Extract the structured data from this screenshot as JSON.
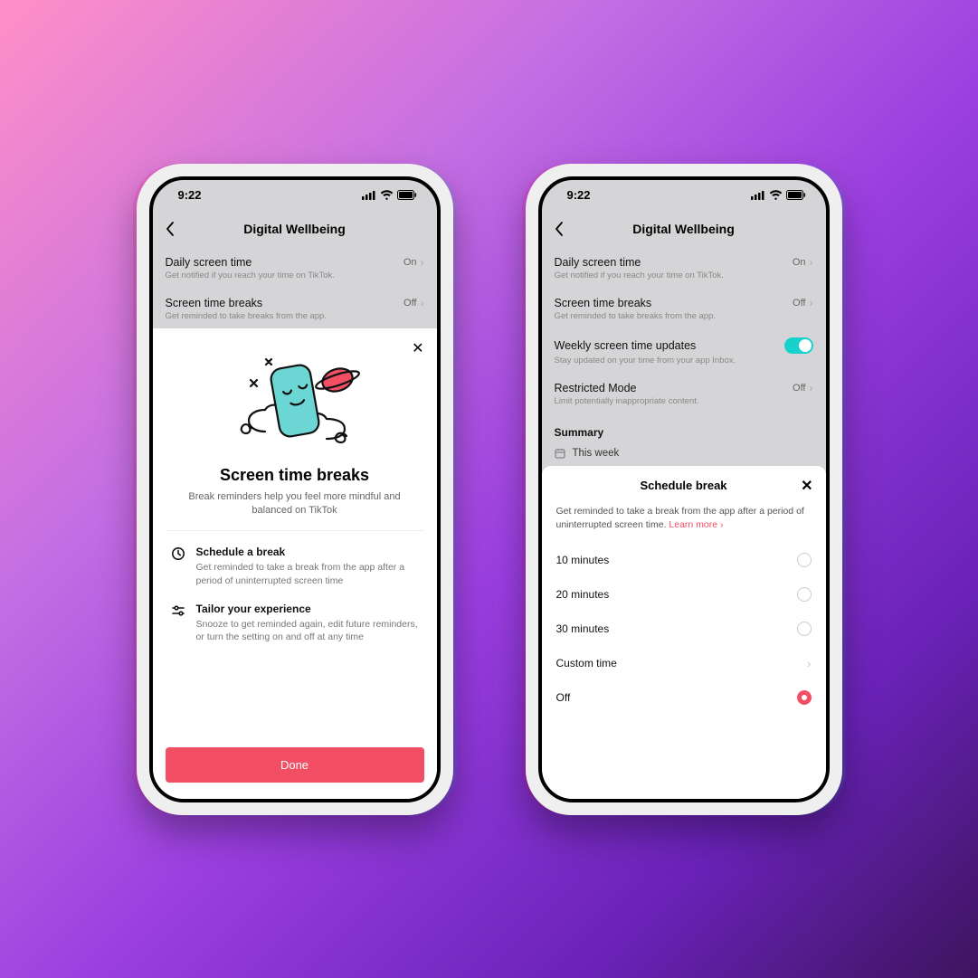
{
  "status": {
    "time": "9:22"
  },
  "nav": {
    "title": "Digital Wellbeing"
  },
  "settings": {
    "daily": {
      "title": "Daily screen time",
      "sub": "Get notified if you reach your time on TikTok.",
      "value": "On"
    },
    "breaks": {
      "title": "Screen time breaks",
      "sub": "Get reminded to take breaks from the app.",
      "value": "Off"
    },
    "weekly": {
      "title": "Weekly screen time updates",
      "sub": "Stay updated on your time from your app Inbox."
    },
    "restricted": {
      "title": "Restricted Mode",
      "sub": "Limit potentially inappropriate content.",
      "value": "Off"
    }
  },
  "summary": {
    "header": "Summary",
    "thisweek": "This week"
  },
  "sheet1": {
    "title": "Screen time breaks",
    "sub": "Break reminders help you feel more mindful and balanced on TikTok",
    "f1t": "Schedule a break",
    "f1d": "Get reminded to take a break from the app after a period of uninterrupted screen time",
    "f2t": "Tailor your experience",
    "f2d": "Snooze to get reminded again, edit future reminders, or turn the setting on and off at any time",
    "done": "Done"
  },
  "sheet2": {
    "header": "Schedule break",
    "desc": "Get reminded to take a break from the app after a period of uninterrupted screen time. ",
    "learn": "Learn more ›",
    "o1": "10 minutes",
    "o2": "20 minutes",
    "o3": "30 minutes",
    "o4": "Custom time",
    "o5": "Off"
  }
}
